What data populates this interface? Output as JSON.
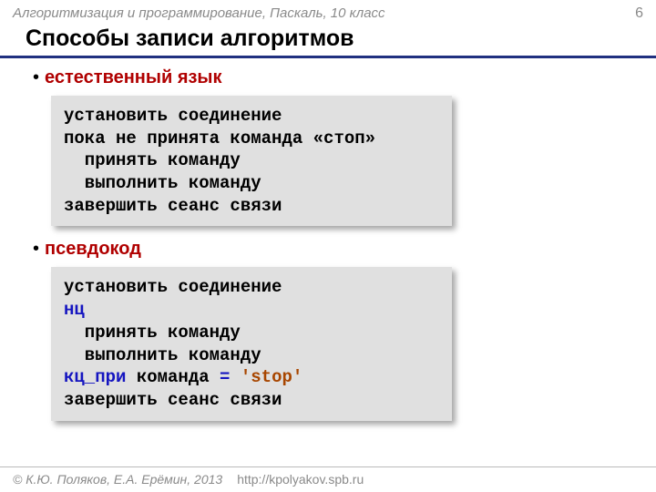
{
  "header": {
    "course": "Алгоритмизация и программирование, Паскаль, 10 класс",
    "page": "6"
  },
  "title": "Способы записи алгоритмов",
  "section1": {
    "bullet": "•",
    "label": "естественный язык",
    "code": "установить соединение\nпока не принята команда «стоп»\n  принять команду\n  выполнить команду\nзавершить сеанс связи"
  },
  "section2": {
    "bullet": "•",
    "label": "псевдокод",
    "code_l1": "установить соединение",
    "code_l2": "нц",
    "code_l3": "  принять команду",
    "code_l4": "  выполнить команду",
    "code_l5a": "кц_при",
    "code_l5b": " команда ",
    "code_l5c": "=",
    "code_l5d": " ",
    "code_l5e": "'stop'",
    "code_l6": "завершить сеанс связи"
  },
  "footer": {
    "copyright": "© К.Ю. Поляков, Е.А. Ерёмин, 2013",
    "url": "http://kpolyakov.spb.ru"
  }
}
